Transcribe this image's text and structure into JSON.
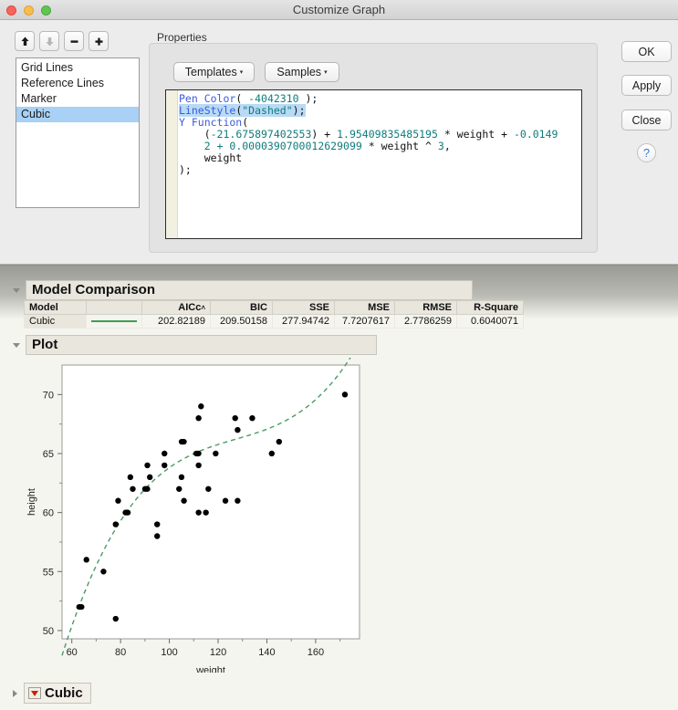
{
  "window": {
    "title": "Customize Graph",
    "traffic_lights": [
      "close-red",
      "minimize-yellow",
      "zoom-green"
    ]
  },
  "toolbar": {
    "move_up": "move-up-icon",
    "move_down": "move-down-icon",
    "remove": "minus-icon",
    "add": "plus-icon"
  },
  "list": {
    "items": [
      {
        "label": "Grid Lines",
        "selected": false
      },
      {
        "label": "Reference Lines",
        "selected": false
      },
      {
        "label": "Marker",
        "selected": false
      },
      {
        "label": "Cubic",
        "selected": true
      }
    ]
  },
  "properties": {
    "group_label": "Properties",
    "templates_button": "Templates",
    "samples_button": "Samples",
    "caret": "▾",
    "code_lines": [
      {
        "segments": [
          {
            "t": "Pen Color",
            "c": "kw"
          },
          {
            "t": "( ",
            "c": ""
          },
          {
            "t": "-4042310",
            "c": "num"
          },
          {
            "t": " );",
            "c": ""
          }
        ]
      },
      {
        "highlight": true,
        "segments": [
          {
            "t": "LineStyle",
            "c": "kw"
          },
          {
            "t": "(",
            "c": ""
          },
          {
            "t": "\"Dashed\"",
            "c": "str"
          },
          {
            "t": ");",
            "c": ""
          }
        ]
      },
      {
        "segments": [
          {
            "t": "Y Function",
            "c": "kw"
          },
          {
            "t": "(",
            "c": ""
          }
        ]
      },
      {
        "segments": [
          {
            "t": "    (",
            "c": ""
          },
          {
            "t": "-21.675897402553",
            "c": "num"
          },
          {
            "t": ") + ",
            "c": ""
          },
          {
            "t": "1.95409835485195",
            "c": "num"
          },
          {
            "t": " * weight + ",
            "c": ""
          },
          {
            "t": "-0.0149",
            "c": "num"
          }
        ]
      },
      {
        "segments": [
          {
            "t": "    2 + ",
            "c": "num"
          },
          {
            "t": "0.0000390700012629099",
            "c": "num"
          },
          {
            "t": " * weight ^ ",
            "c": ""
          },
          {
            "t": "3",
            "c": "num"
          },
          {
            "t": ",",
            "c": ""
          }
        ]
      },
      {
        "segments": [
          {
            "t": "    weight",
            "c": ""
          }
        ]
      },
      {
        "segments": [
          {
            "t": ");",
            "c": ""
          }
        ]
      }
    ]
  },
  "buttons": {
    "ok": "OK",
    "apply": "Apply",
    "close": "Close",
    "help": "?"
  },
  "report": {
    "model_comparison": {
      "title": "Model Comparison",
      "columns": [
        "Model",
        "",
        "AICc",
        "BIC",
        "SSE",
        "MSE",
        "RMSE",
        "R-Square"
      ],
      "sorted_column": "AICc",
      "sort_caret": "˄",
      "rows": [
        {
          "model": "Cubic",
          "color": "#3f9b55",
          "AICc": "202.82189",
          "BIC": "209.50158",
          "SSE": "277.94742",
          "MSE": "7.7207617",
          "RMSE": "2.7786259",
          "R-Square": "0.6040071"
        }
      ]
    },
    "plot_title": "Plot",
    "footer": {
      "label": "Cubic",
      "disclosure": "red-triangle-icon"
    }
  },
  "chart_data": {
    "type": "scatter",
    "title": "Plot",
    "xlabel": "weight",
    "ylabel": "height",
    "xlim": [
      56,
      178
    ],
    "ylim": [
      49.3,
      72.5
    ],
    "xticks": [
      60,
      80,
      100,
      120,
      140,
      160
    ],
    "yticks": [
      50,
      55,
      60,
      65,
      70
    ],
    "grid": false,
    "marker_color": "#000000",
    "fit_line": {
      "name": "Cubic",
      "color": "#4a9b63",
      "style": "dashed",
      "coefficients": {
        "intercept": -21.675897402553,
        "weight": 1.95409835485195,
        "weight_sq": -0.0149,
        "weight_cube": 3.90700012629099e-05
      }
    },
    "points": [
      {
        "x": 63,
        "y": 52
      },
      {
        "x": 64,
        "y": 52
      },
      {
        "x": 66,
        "y": 56
      },
      {
        "x": 73,
        "y": 55
      },
      {
        "x": 78,
        "y": 51
      },
      {
        "x": 78,
        "y": 59
      },
      {
        "x": 79,
        "y": 61
      },
      {
        "x": 82,
        "y": 60
      },
      {
        "x": 83,
        "y": 60
      },
      {
        "x": 84,
        "y": 63
      },
      {
        "x": 85,
        "y": 62
      },
      {
        "x": 90,
        "y": 62
      },
      {
        "x": 91,
        "y": 62
      },
      {
        "x": 91,
        "y": 64
      },
      {
        "x": 92,
        "y": 63
      },
      {
        "x": 95,
        "y": 58
      },
      {
        "x": 95,
        "y": 59
      },
      {
        "x": 98,
        "y": 64
      },
      {
        "x": 98,
        "y": 65
      },
      {
        "x": 104,
        "y": 62
      },
      {
        "x": 105,
        "y": 63
      },
      {
        "x": 105,
        "y": 66
      },
      {
        "x": 106,
        "y": 66
      },
      {
        "x": 106,
        "y": 61
      },
      {
        "x": 111,
        "y": 65
      },
      {
        "x": 112,
        "y": 65
      },
      {
        "x": 112,
        "y": 60
      },
      {
        "x": 112,
        "y": 64
      },
      {
        "x": 112,
        "y": 68
      },
      {
        "x": 113,
        "y": 69
      },
      {
        "x": 115,
        "y": 60
      },
      {
        "x": 116,
        "y": 62
      },
      {
        "x": 119,
        "y": 65
      },
      {
        "x": 123,
        "y": 61
      },
      {
        "x": 127,
        "y": 68
      },
      {
        "x": 128,
        "y": 61
      },
      {
        "x": 128,
        "y": 67
      },
      {
        "x": 134,
        "y": 68
      },
      {
        "x": 142,
        "y": 65
      },
      {
        "x": 145,
        "y": 66
      },
      {
        "x": 172,
        "y": 70
      }
    ]
  }
}
